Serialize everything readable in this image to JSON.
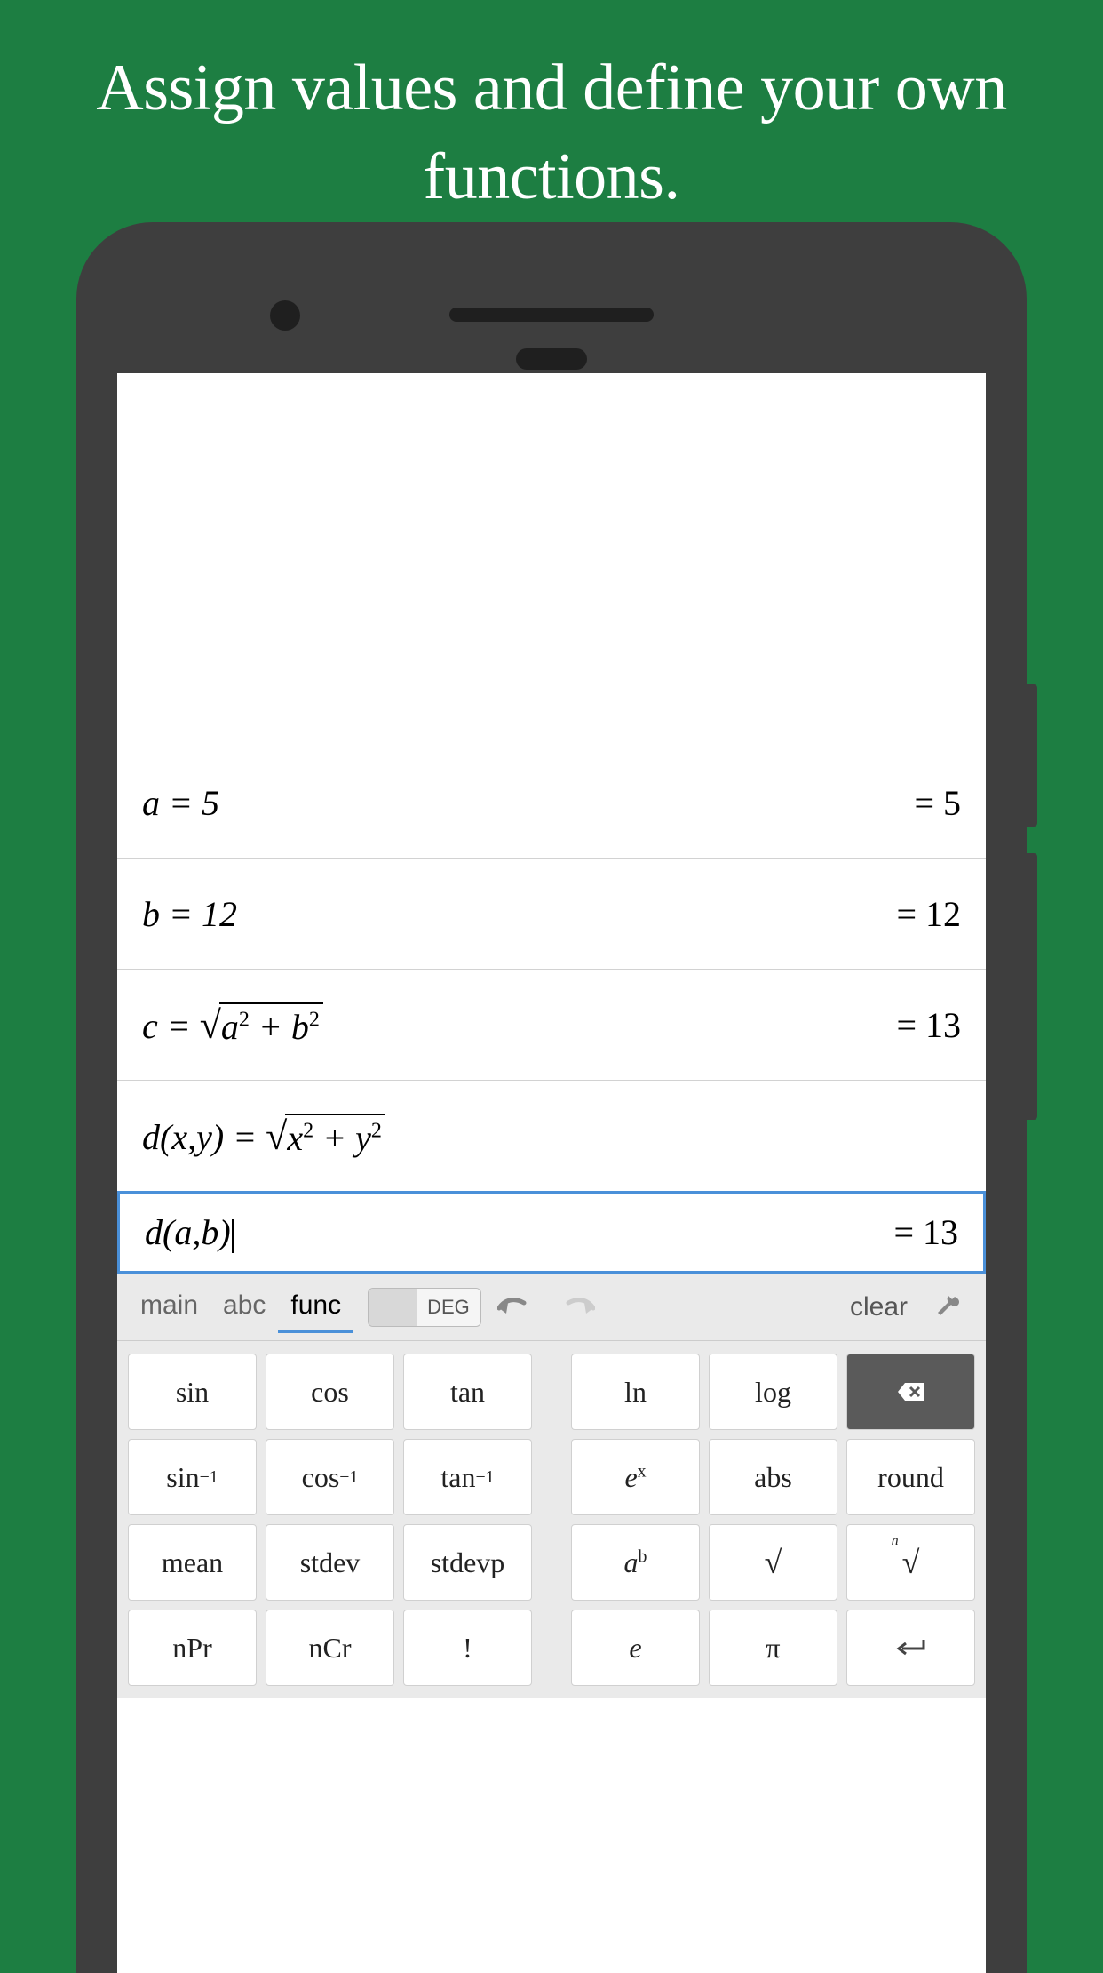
{
  "headline": "Assign values and define your own functions.",
  "history": [
    {
      "expr_html": "<span class='ital'>a</span> = 5",
      "result": "= 5"
    },
    {
      "expr_html": "<span class='ital'>b</span> = 12",
      "result": "= 12"
    },
    {
      "expr_html": "<span class='ital'>c</span> = <span class='sqrt-wrap'><span class='sqrt-sign'>√</span><span class='sqrt-body'><span class='ital'>a</span><sup>2</sup> + <span class='ital'>b</span><sup>2</sup></span></span>",
      "result": "= 13"
    },
    {
      "expr_html": "<span class='ital'>d</span>(<span class='ital'>x</span>,<span class='ital'>y</span>) = <span class='sqrt-wrap'><span class='sqrt-sign'>√</span><span class='sqrt-body'><span class='ital'>x</span><sup>2</sup> + <span class='ital'>y</span><sup>2</sup></span></span>",
      "result": ""
    }
  ],
  "active_input": {
    "expr_html": "<span class='ital'>d</span>(<span class='ital'>a</span>,<span class='ital'>b</span>)<span class='cursor'></span>",
    "result": "= 13"
  },
  "toolbar": {
    "tabs": [
      "main",
      "abc",
      "func"
    ],
    "active_tab_index": 2,
    "deg_label": "DEG",
    "clear_label": "clear"
  },
  "keypad": [
    [
      {
        "label": "sin"
      },
      {
        "label": "cos"
      },
      {
        "label": "tan"
      },
      {
        "gap": true
      },
      {
        "label": "ln"
      },
      {
        "label": "log"
      },
      {
        "icon": "backspace",
        "dark": true
      }
    ],
    [
      {
        "html": "sin<sup>−1</sup>"
      },
      {
        "html": "cos<sup>−1</sup>"
      },
      {
        "html": "tan<sup>−1</sup>"
      },
      {
        "gap": true
      },
      {
        "html": "<span class='ital'>e<sup>x</sup></span>"
      },
      {
        "label": "abs"
      },
      {
        "label": "round"
      }
    ],
    [
      {
        "label": "mean"
      },
      {
        "label": "stdev"
      },
      {
        "label": "stdevp"
      },
      {
        "gap": true
      },
      {
        "html": "<span class='ital'>a<sup>b</sup></span>"
      },
      {
        "html": "<span class='sqrt-k'>√</span>"
      },
      {
        "html": "<span class='nroot'><span class='n'>n</span><span class='sqrt-k'>√</span></span>"
      }
    ],
    [
      {
        "label": "nPr"
      },
      {
        "label": "nCr"
      },
      {
        "label": "!"
      },
      {
        "gap": true
      },
      {
        "html": "<span class='ital'>e</span>"
      },
      {
        "label": "π"
      },
      {
        "icon": "enter"
      }
    ]
  ]
}
